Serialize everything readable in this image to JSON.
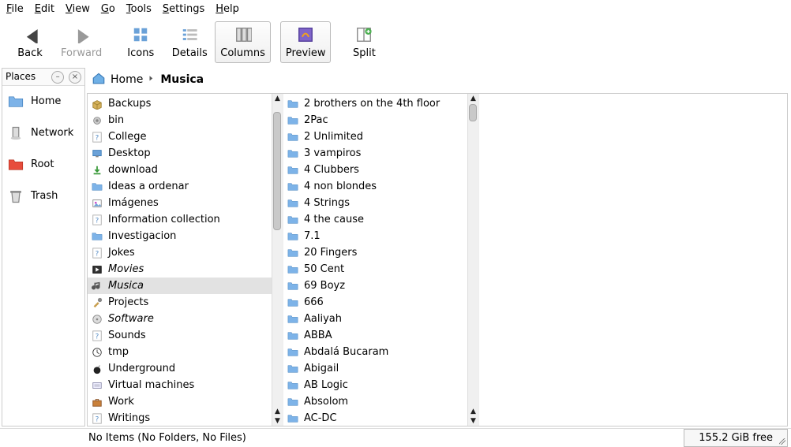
{
  "menu": [
    "File",
    "Edit",
    "View",
    "Go",
    "Tools",
    "Settings",
    "Help"
  ],
  "toolbar": [
    {
      "id": "back",
      "label": "Back",
      "icon": "arrow-left",
      "disabled": false
    },
    {
      "id": "forward",
      "label": "Forward",
      "icon": "arrow-right",
      "disabled": true
    },
    {
      "sep": true
    },
    {
      "id": "icons",
      "label": "Icons",
      "icon": "grid"
    },
    {
      "id": "details",
      "label": "Details",
      "icon": "list"
    },
    {
      "id": "columns",
      "label": "Columns",
      "icon": "columns",
      "active": true
    },
    {
      "sep": true
    },
    {
      "id": "preview",
      "label": "Preview",
      "icon": "preview",
      "active": true
    },
    {
      "sep": true
    },
    {
      "id": "split",
      "label": "Split",
      "icon": "split"
    }
  ],
  "sidebar": {
    "title": "Places",
    "items": [
      {
        "id": "home",
        "label": "Home",
        "icon": "folder-blue"
      },
      {
        "id": "network",
        "label": "Network",
        "icon": "network"
      },
      {
        "id": "root",
        "label": "Root",
        "icon": "folder-red"
      },
      {
        "id": "trash",
        "label": "Trash",
        "icon": "trash"
      }
    ]
  },
  "breadcrumb": [
    {
      "label": "Home",
      "current": false,
      "icon": true
    },
    {
      "label": "Musica",
      "current": true
    }
  ],
  "columns": [
    {
      "scroll": {
        "thumbTop": 10,
        "thumbHeight": 150,
        "showArrows": true,
        "bottomArrows": true
      },
      "items": [
        {
          "label": "Backups",
          "icon": "pkg"
        },
        {
          "label": "bin",
          "icon": "gear"
        },
        {
          "label": "College",
          "icon": "unknown"
        },
        {
          "label": "Desktop",
          "icon": "desktop"
        },
        {
          "label": "download",
          "icon": "download"
        },
        {
          "label": "Ideas a ordenar",
          "icon": "folder"
        },
        {
          "label": "Imágenes",
          "icon": "image"
        },
        {
          "label": "Information collection",
          "icon": "unknown"
        },
        {
          "label": "Investigacion",
          "icon": "folder"
        },
        {
          "label": "Jokes",
          "icon": "unknown"
        },
        {
          "label": "Movies",
          "icon": "video",
          "italic": true
        },
        {
          "label": "Musica",
          "icon": "audio",
          "italic": true,
          "selected": true
        },
        {
          "label": "Projects",
          "icon": "tool"
        },
        {
          "label": "Software",
          "icon": "disk",
          "italic": true
        },
        {
          "label": "Sounds",
          "icon": "unknown"
        },
        {
          "label": "tmp",
          "icon": "clock"
        },
        {
          "label": "Underground",
          "icon": "bomb"
        },
        {
          "label": "Virtual machines",
          "icon": "vm"
        },
        {
          "label": "Work",
          "icon": "briefcase"
        },
        {
          "label": "Writings",
          "icon": "unknown"
        }
      ]
    },
    {
      "scroll": {
        "thumbTop": 0,
        "thumbHeight": 22,
        "showArrows": true,
        "bottomArrows": true
      },
      "items": [
        {
          "label": "2 brothers on the 4th floor",
          "icon": "folder"
        },
        {
          "label": "2Pac",
          "icon": "folder"
        },
        {
          "label": "2 Unlimited",
          "icon": "folder"
        },
        {
          "label": "3 vampiros",
          "icon": "folder"
        },
        {
          "label": "4 Clubbers",
          "icon": "folder"
        },
        {
          "label": "4 non blondes",
          "icon": "folder"
        },
        {
          "label": "4 Strings",
          "icon": "folder"
        },
        {
          "label": "4 the cause",
          "icon": "folder"
        },
        {
          "label": "7.1",
          "icon": "folder"
        },
        {
          "label": "20 Fingers",
          "icon": "folder"
        },
        {
          "label": "50 Cent",
          "icon": "folder"
        },
        {
          "label": "69 Boyz",
          "icon": "folder"
        },
        {
          "label": "666",
          "icon": "folder"
        },
        {
          "label": "Aaliyah",
          "icon": "folder"
        },
        {
          "label": "ABBA",
          "icon": "folder"
        },
        {
          "label": "Abdalá Bucaram",
          "icon": "folder"
        },
        {
          "label": "Abigail",
          "icon": "folder"
        },
        {
          "label": "AB Logic",
          "icon": "folder"
        },
        {
          "label": "Absolom",
          "icon": "folder"
        },
        {
          "label": "AC-DC",
          "icon": "folder"
        }
      ]
    }
  ],
  "status": {
    "left": "No Items (No Folders, No Files)",
    "right": "155.2 GiB free"
  }
}
